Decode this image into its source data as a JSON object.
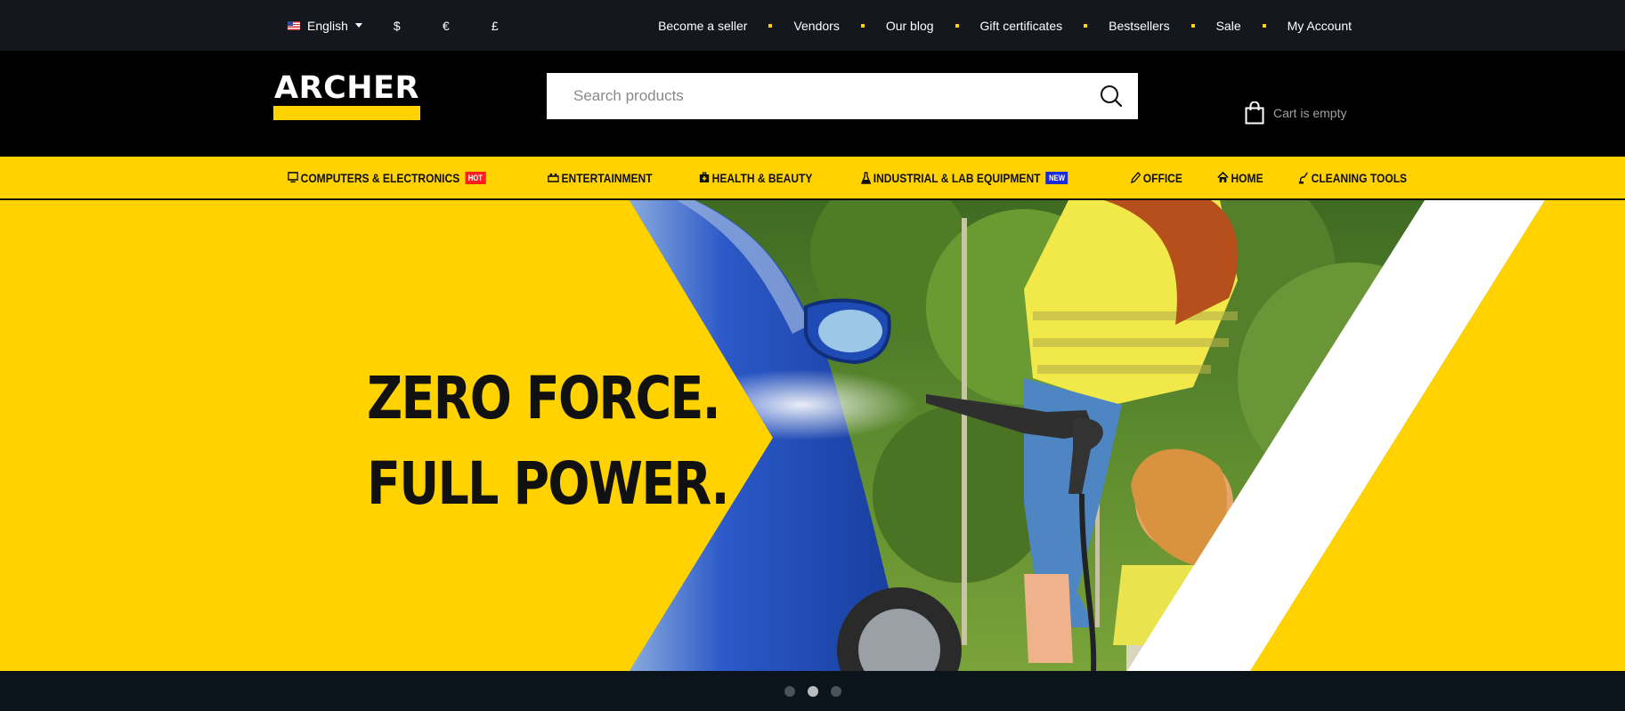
{
  "topbar": {
    "language": "English",
    "currencies": [
      "$",
      "€",
      "£"
    ],
    "links": [
      "Become a seller",
      "Vendors",
      "Our blog",
      "Gift certificates",
      "Bestsellers",
      "Sale",
      "My Account"
    ]
  },
  "header": {
    "logo": "ARCHER",
    "search_placeholder": "Search products",
    "cart_label": "Cart is empty"
  },
  "nav": {
    "items": [
      {
        "label": "COMPUTERS & ELECTRONICS",
        "badge": "HOT",
        "icon": "monitor-icon"
      },
      {
        "label": "ENTERTAINMENT",
        "badge": "",
        "icon": "entertainment-icon"
      },
      {
        "label": "HEALTH & BEAUTY",
        "badge": "",
        "icon": "medkit-icon"
      },
      {
        "label": "INDUSTRIAL & LAB EQUIPMENT",
        "badge": "NEW",
        "icon": "flask-icon"
      },
      {
        "label": "OFFICE",
        "badge": "",
        "icon": "pencil-icon"
      },
      {
        "label": "HOME",
        "badge": "",
        "icon": "home-icon"
      },
      {
        "label": "CLEANING TOOLS",
        "badge": "",
        "icon": "vacuum-icon"
      }
    ]
  },
  "hero": {
    "line1": "ZERO FORCE.",
    "line2": "FULL POWER."
  },
  "slider": {
    "slide_count": 3,
    "active_slide": 2
  },
  "colors": {
    "accent": "#ffd200",
    "topbar_bg": "#14171d",
    "header_bg": "#000000",
    "hot_badge": "#ff1e1e",
    "new_badge": "#1a2bd8"
  }
}
